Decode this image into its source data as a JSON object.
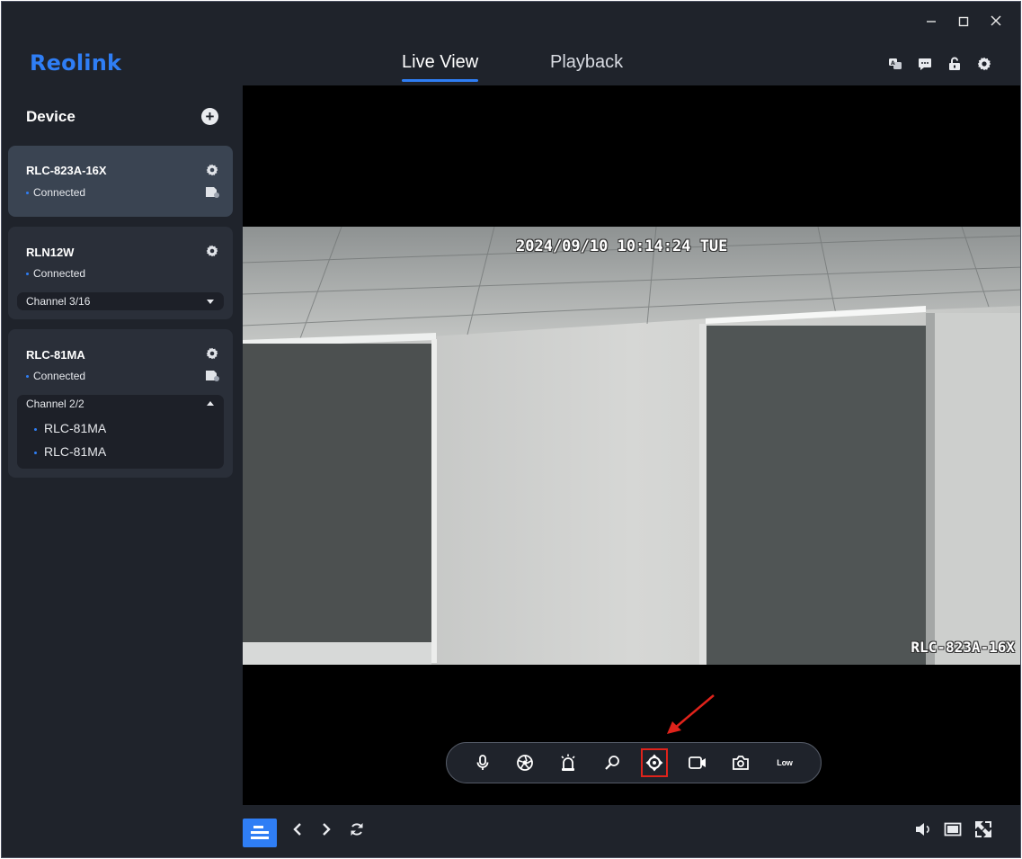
{
  "app": {
    "logo": "Reolink",
    "accent_color": "#2f7ef5"
  },
  "window_controls": [
    "minimize-icon",
    "maximize-icon",
    "close-icon"
  ],
  "nav": {
    "tabs": [
      {
        "label": "Live View",
        "active": true
      },
      {
        "label": "Playback",
        "active": false
      }
    ]
  },
  "header_tools": [
    "translate-icon",
    "message-icon",
    "unlock-icon",
    "settings-icon"
  ],
  "sidebar": {
    "title": "Device",
    "add_icon": "plus-circle-icon",
    "devices": [
      {
        "name": "RLC-823A-16X",
        "status": "Connected",
        "selected": true,
        "storage_icon": "sd-card-icon"
      },
      {
        "name": "RLN12W",
        "status": "Connected",
        "selected": false,
        "channel": {
          "label": "Channel 3/16",
          "expanded": false
        }
      },
      {
        "name": "RLC-81MA",
        "status": "Connected",
        "selected": false,
        "storage_icon": "sd-card-icon",
        "channel": {
          "label": "Channel 2/2",
          "expanded": true,
          "items": [
            "RLC-81MA",
            "RLC-81MA"
          ]
        }
      }
    ]
  },
  "video": {
    "timestamp": "2024/09/10 10:14:24 TUE",
    "camera_name": "RLC-823A-16X"
  },
  "toolbar": {
    "tools": [
      {
        "name": "microphone-icon"
      },
      {
        "name": "spotlight-icon"
      },
      {
        "name": "siren-icon"
      },
      {
        "name": "zoom-icon"
      },
      {
        "name": "ptz-icon",
        "highlighted": true
      },
      {
        "name": "record-icon"
      },
      {
        "name": "snapshot-icon"
      }
    ],
    "stream_label": "Low",
    "highlight_color": "#e0231b"
  },
  "bottom_bar": {
    "left": [
      "layout-icon",
      "previous-icon",
      "next-icon",
      "refresh-icon"
    ],
    "right": [
      "volume-icon",
      "aspect-ratio-icon",
      "fullscreen-icon"
    ]
  }
}
